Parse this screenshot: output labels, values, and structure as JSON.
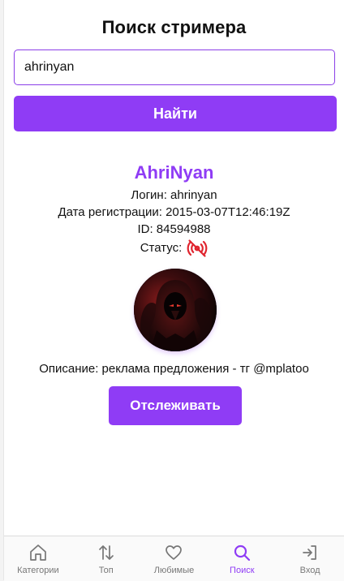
{
  "header": {
    "title": "Поиск стримера"
  },
  "search": {
    "value": "ahrinyan",
    "button_label": "Найти"
  },
  "profile": {
    "display_name": "AhriNyan",
    "login_label": "Логин: ahrinyan",
    "registered_label": "Дата регистрации: 2015-03-07T12:46:19Z",
    "id_label": "ID: 84594988",
    "status_label": "Статус:",
    "status_icon": "offline-broadcast-icon",
    "description": "Описание: реклама предложения - тг @mplatoo",
    "follow_label": "Отслеживать"
  },
  "nav": {
    "items": [
      {
        "label": "Категории",
        "icon": "home-icon",
        "active": false
      },
      {
        "label": "Топ",
        "icon": "sort-arrows-icon",
        "active": false
      },
      {
        "label": "Любимые",
        "icon": "heart-icon",
        "active": false
      },
      {
        "label": "Поиск",
        "icon": "search-icon",
        "active": true
      },
      {
        "label": "Вход",
        "icon": "login-icon",
        "active": false
      }
    ]
  },
  "colors": {
    "accent": "#8f3cf5",
    "offline": "#e0252f",
    "nav_inactive": "#777777"
  }
}
